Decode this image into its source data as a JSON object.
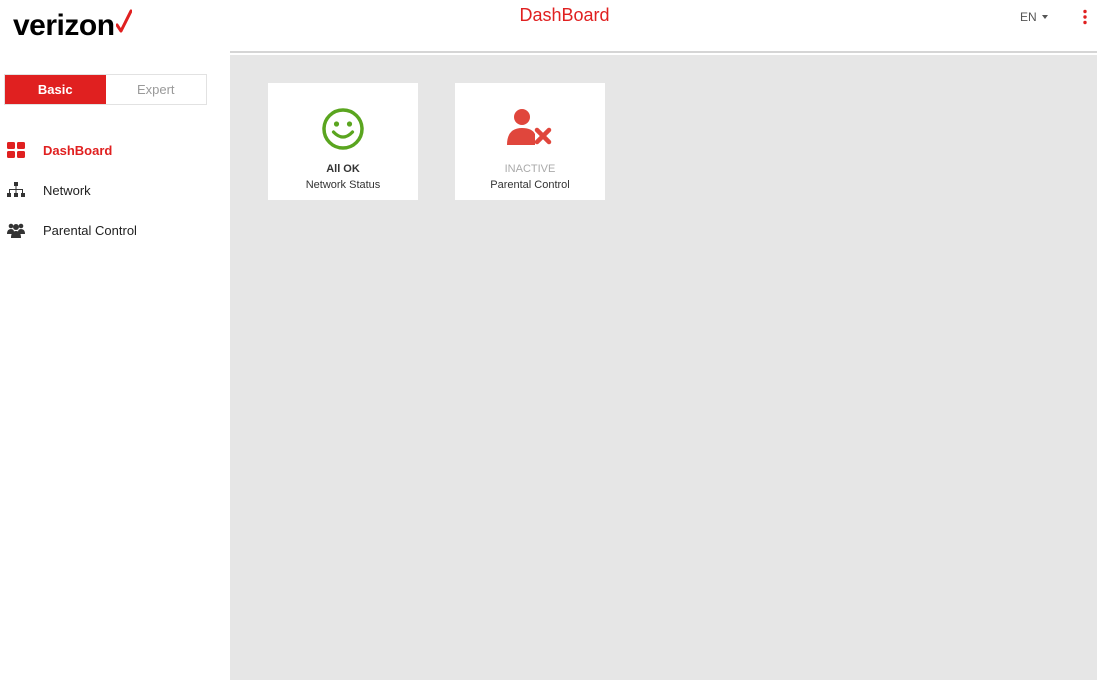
{
  "brand": {
    "logo_text": "verizon",
    "accent_color": "#e02020"
  },
  "sidebar": {
    "mode_toggle": {
      "basic_label": "Basic",
      "expert_label": "Expert",
      "selected": "Basic"
    },
    "nav_items": [
      {
        "label": "DashBoard",
        "icon": "dashboard-grid-icon",
        "active": true
      },
      {
        "label": "Network",
        "icon": "network-hierarchy-icon",
        "active": false
      },
      {
        "label": "Parental Control",
        "icon": "users-group-icon",
        "active": false
      }
    ]
  },
  "header": {
    "title": "DashBoard",
    "language": "EN",
    "menu_icon": "kebab-menu-icon"
  },
  "dashboard": {
    "cards": [
      {
        "value": "All OK",
        "label": "Network Status",
        "icon": "smiley-face-icon",
        "status_color": "#5aa51f"
      },
      {
        "value": "INACTIVE",
        "label": "Parental Control",
        "icon": "user-blocked-icon",
        "status_color": "#e0463c"
      }
    ]
  }
}
